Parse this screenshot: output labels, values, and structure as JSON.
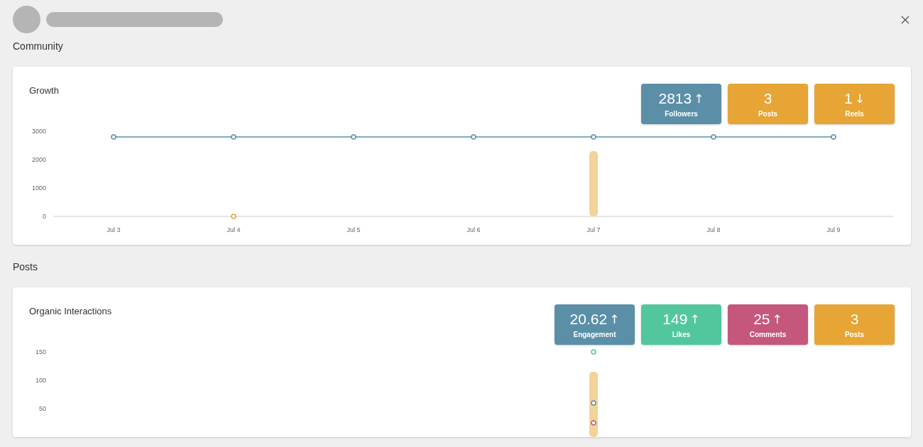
{
  "sections": [
    {
      "title": "Community",
      "card_title": "Growth",
      "stats": [
        {
          "value": "2813",
          "arrow": "↑",
          "label": "Followers",
          "color": "#5b8fa8"
        },
        {
          "value": "3",
          "label": "Posts",
          "color": "#e6a535"
        },
        {
          "value": "1",
          "arrow": "↓",
          "label": "Reels",
          "color": "#e6a535"
        }
      ],
      "chart_data": {
        "type": "bar",
        "categories": [
          "Jul 3",
          "Jul 4",
          "Jul 5",
          "Jul 6",
          "Jul 7",
          "Jul 8",
          "Jul 9"
        ],
        "yticks": [
          0,
          1000,
          2000,
          3000
        ],
        "ylim": [
          0,
          3000
        ],
        "series": [
          {
            "color": "#f3d399",
            "values": [
              null,
              null,
              null,
              null,
              2300,
              null,
              null
            ]
          },
          {
            "type": "line",
            "marker": true,
            "color": "#5b8fa8",
            "values": [
              2800,
              2800,
              2800,
              2800,
              2800,
              2800,
              2800
            ]
          },
          {
            "type": "scatter",
            "marker": true,
            "color": "#e6a535",
            "values": [
              null,
              0,
              null,
              null,
              null,
              null,
              null
            ]
          }
        ]
      }
    },
    {
      "title": "Posts",
      "card_title": "Organic Interactions",
      "stats": [
        {
          "value": "20.62",
          "arrow": "↑",
          "label": "Engagement",
          "color": "#5b8fa8"
        },
        {
          "value": "149",
          "arrow": "↑",
          "label": "Likes",
          "color": "#52c79e"
        },
        {
          "value": "25",
          "arrow": "↑",
          "label": "Comments",
          "color": "#c6577c"
        },
        {
          "value": "3",
          "label": "Posts",
          "color": "#e6a535"
        }
      ],
      "chart_data": {
        "type": "bar",
        "yticks": [
          50,
          100,
          150
        ],
        "ylim": [
          0,
          150
        ],
        "series": [
          {
            "color": "#f3d399",
            "values": [
              null,
              null,
              null,
              null,
              115,
              null,
              null
            ]
          },
          {
            "type": "scatter",
            "marker": true,
            "color": "#52c79e",
            "values": [
              null,
              null,
              null,
              null,
              150,
              null,
              null
            ]
          },
          {
            "type": "scatter",
            "marker": true,
            "color": "#5b8fa8",
            "values": [
              null,
              null,
              null,
              null,
              60,
              null,
              null
            ]
          },
          {
            "type": "scatter",
            "marker": true,
            "color": "#c6577c",
            "values": [
              null,
              null,
              null,
              null,
              25,
              null,
              null
            ]
          }
        ]
      }
    }
  ]
}
